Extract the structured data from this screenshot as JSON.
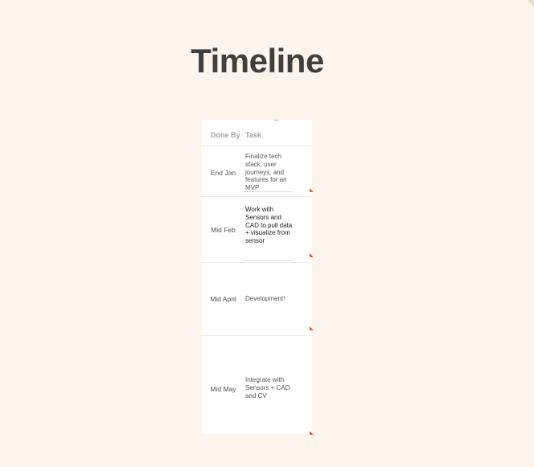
{
  "page": {
    "title": "Timeline"
  },
  "table": {
    "headers": {
      "done_by": "Done By",
      "task": "Task"
    },
    "rows": [
      {
        "done_by": "End Jan",
        "task": "Finalize tech stack, user journeys, and features for an MVP"
      },
      {
        "done_by": "Mid Feb",
        "task": "Work with Sensors and CAD to pull data + visualize from sensor"
      },
      {
        "done_by": "Mid April",
        "task": "Development!"
      },
      {
        "done_by": "Mid May",
        "task": "Integrate with Sensors + CAD and CV"
      }
    ]
  },
  "colors": {
    "background": "#fdf5eb",
    "title": "#3f3f3f",
    "table_background": "#ffffff",
    "header_text": "#a3a3a3",
    "body_text": "#555555",
    "marker": "#d9473a"
  }
}
